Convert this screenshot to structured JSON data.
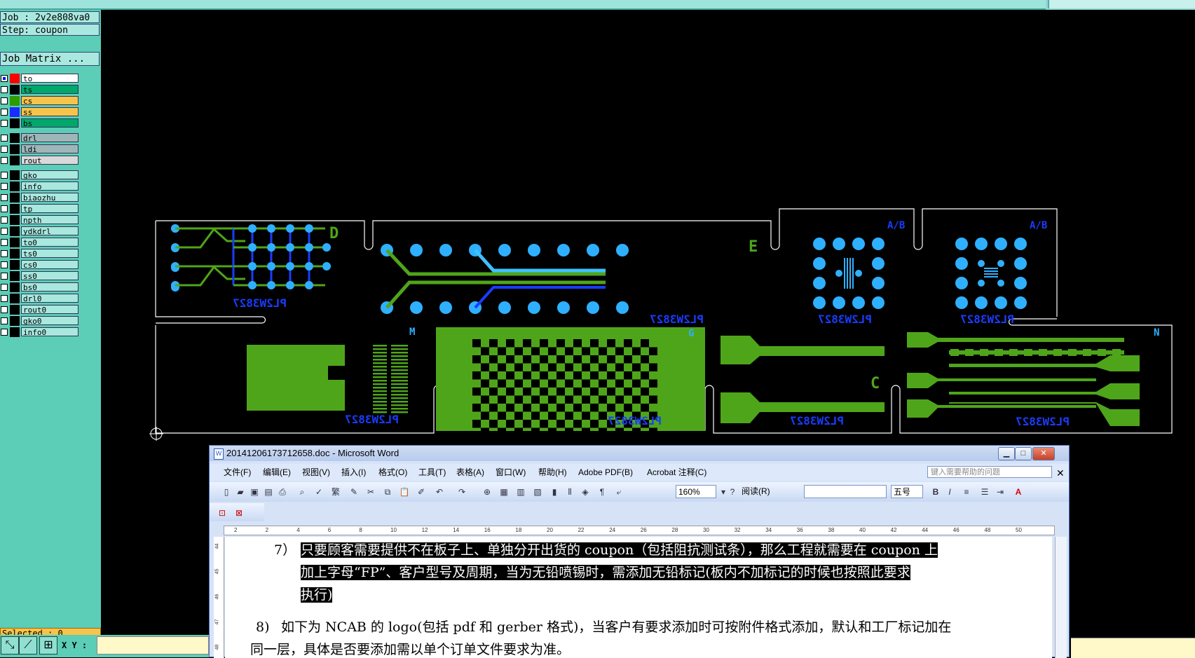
{
  "cam": {
    "job": "Job : 2v2e808va0",
    "step": "Step: coupon",
    "matrix_button": "Job Matrix ...",
    "selected": "Selected : 0",
    "xy_label": "X Y :",
    "layers": [
      {
        "name": "to",
        "color": "#ffffff",
        "swatch": "#ff0000",
        "selected": true
      },
      {
        "name": "ts",
        "color": "#00a86b",
        "swatch": "#000000"
      },
      {
        "name": "cs",
        "color": "#f6c44a",
        "swatch": "#2e9b00"
      },
      {
        "name": "ss",
        "color": "#f6c44a",
        "swatch": "#1a2bff"
      },
      {
        "name": "bs",
        "color": "#00a86b",
        "swatch": "#000000"
      },
      {
        "name": "drl",
        "color": "#9fb6b9",
        "swatch": "#000000"
      },
      {
        "name": "ldi",
        "color": "#9fb6b9",
        "swatch": "#000000"
      },
      {
        "name": "rout",
        "color": "#d9d9d9",
        "swatch": "#000000"
      },
      {
        "name": "gko",
        "color": "#a9e8de",
        "swatch": "#000000"
      },
      {
        "name": "info",
        "color": "#a9e8de",
        "swatch": "#000000"
      },
      {
        "name": "biaozhu",
        "color": "#a9e8de",
        "swatch": "#000000"
      },
      {
        "name": "tp",
        "color": "#a9e8de",
        "swatch": "#000000"
      },
      {
        "name": "npth",
        "color": "#a9e8de",
        "swatch": "#000000"
      },
      {
        "name": "ydkdrl",
        "color": "#a9e8de",
        "swatch": "#000000"
      },
      {
        "name": "to0",
        "color": "#a9e8de",
        "swatch": "#000000"
      },
      {
        "name": "ts0",
        "color": "#a9e8de",
        "swatch": "#000000"
      },
      {
        "name": "cs0",
        "color": "#a9e8de",
        "swatch": "#000000"
      },
      {
        "name": "ss0",
        "color": "#a9e8de",
        "swatch": "#000000"
      },
      {
        "name": "bs0",
        "color": "#a9e8de",
        "swatch": "#000000"
      },
      {
        "name": "drl0",
        "color": "#a9e8de",
        "swatch": "#000000"
      },
      {
        "name": "rout0",
        "color": "#a9e8de",
        "swatch": "#000000"
      },
      {
        "name": "gko0",
        "color": "#a9e8de",
        "swatch": "#000000"
      },
      {
        "name": "info0",
        "color": "#a9e8de",
        "swatch": "#000000"
      }
    ],
    "coupon_labels": {
      "D": "D",
      "E": "E",
      "AB1": "A/B",
      "AB2": "A/B",
      "M": "M",
      "G": "G",
      "C": "C",
      "N": "N",
      "mirror_text": "PL2W3827"
    },
    "colors": {
      "green": "#4fa51a",
      "blue_pad": "#2fb0ff",
      "cyan_trace": "#40c0ff",
      "dark_blue": "#1a3cff",
      "outline": "#ffffff"
    }
  },
  "word": {
    "title": "20141206173712658.doc - Microsoft Word",
    "menus": [
      "文件(F)",
      "编辑(E)",
      "视图(V)",
      "插入(I)",
      "格式(O)",
      "工具(T)",
      "表格(A)",
      "窗口(W)",
      "帮助(H)",
      "Adobe PDF(B)",
      "Acrobat 注释(C)"
    ],
    "help_placeholder": "键入需要帮助的问题",
    "zoom": "160%",
    "read_label": "阅读(R)",
    "font_size": "五号",
    "para7_num": "7）",
    "para7_line1": "只要顾客需要提供不在板子上、单独分开出货的 coupon（包括阻抗测试条），那么工程就需要在 coupon 上",
    "para7_line2": "加上字母“FP”、客户型号及周期，当为无铅喷锡时，需添加无铅标记(板内不加标记的时候也按照此要求",
    "para7_line3": "执行)",
    "para8_num": "8)",
    "para8_line1": "如下为 NCAB 的 logo(包括 pdf 和 gerber 格式)，当客户有要求添加时可按附件格式添加，默认和工厂标记加在",
    "para8_line2": "同一层，具体是否要添加需以单个订单文件要求为准。",
    "ruler_ticks": [
      "2",
      "2",
      "4",
      "6",
      "8",
      "10",
      "12",
      "14",
      "16",
      "18",
      "20",
      "22",
      "24",
      "26",
      "28",
      "30",
      "32",
      "34",
      "36",
      "38",
      "40",
      "42",
      "44",
      "46",
      "48",
      "50"
    ],
    "vruler_ticks": [
      "44",
      "45",
      "46",
      "47",
      "48"
    ]
  }
}
